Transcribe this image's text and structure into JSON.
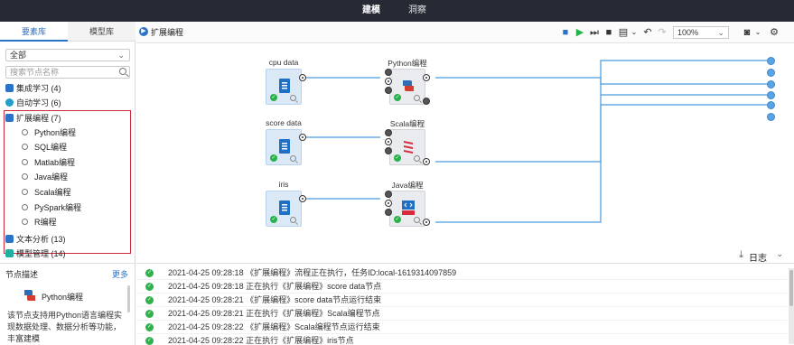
{
  "topbar": {
    "tabs": [
      "建模",
      "洞察"
    ]
  },
  "left": {
    "tabs": [
      "要素库",
      "模型库"
    ],
    "select_value": "全部",
    "search_placeholder": "搜索节点名称",
    "tree": [
      {
        "label": "集成学习 (4)",
        "color": "#2a73c8"
      },
      {
        "label": "自动学习 (6)",
        "color": "#1fa0c8"
      },
      {
        "label": "扩展编程 (7)",
        "color": "#2a73c8"
      },
      {
        "label": "文本分析 (13)",
        "color": "#2a73c8"
      },
      {
        "label": "模型管理 (14)",
        "color": "#1fb0a0"
      }
    ],
    "sub_items": [
      "Python编程",
      "SQL编程",
      "Matlab编程",
      "Java编程",
      "Scala编程",
      "PySpark编程",
      "R编程"
    ],
    "node_desc": {
      "header": "节点描述",
      "more": "更多",
      "title": "Python编程",
      "text": "该节点支持用Python语言编程实现数据处理、数据分析等功能，丰富建模"
    }
  },
  "main": {
    "title": "扩展编程",
    "zoom": "100%",
    "nodes": [
      {
        "label": "cpu data"
      },
      {
        "label": "Python编程"
      },
      {
        "label": "score data"
      },
      {
        "label": "Scala编程"
      },
      {
        "label": "iris"
      },
      {
        "label": "Java编程"
      }
    ],
    "log_title": "日志",
    "logs": [
      "2021-04-25 09:28:18 《扩展编程》流程正在执行，任务ID:local-1619314097859",
      "2021-04-25 09:28:18 正在执行《扩展编程》score data节点",
      "2021-04-25 09:28:21 《扩展编程》score data节点运行结束",
      "2021-04-25 09:28:21 正在执行《扩展编程》Scala编程节点",
      "2021-04-25 09:28:22 《扩展编程》Scala编程节点运行结束",
      "2021-04-25 09:28:22 正在执行《扩展编程》iris节点"
    ]
  },
  "colors": {
    "topbar": "#252a35",
    "accent": "#2a73c8",
    "highlight": "#d0283a",
    "success": "#27b14a"
  }
}
